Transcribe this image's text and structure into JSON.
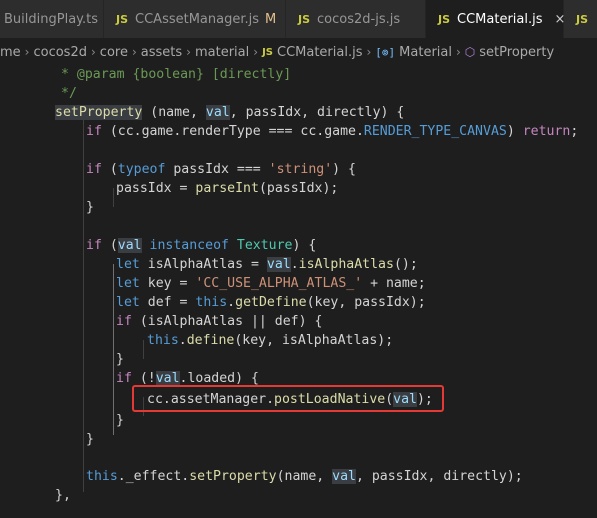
{
  "tabs": [
    {
      "icon": "",
      "label": "BuildingPlay.ts",
      "modified": "",
      "active": false
    },
    {
      "icon": "JS",
      "label": "CCAssetManager.js",
      "modified": "M",
      "active": false
    },
    {
      "icon": "JS",
      "label": "cocos2d-js.js",
      "modified": "",
      "active": false
    },
    {
      "icon": "JS",
      "label": "CCMaterial.js",
      "modified": "",
      "close": "×",
      "active": true
    },
    {
      "icon": "JS",
      "label": "",
      "modified": "",
      "active": false
    }
  ],
  "breadcrumb": {
    "items": [
      "me",
      "cocos2d",
      "core",
      "assets",
      "material"
    ],
    "file": "CCMaterial.js",
    "file_icon": "JS",
    "class": "Material",
    "class_icon": "[⊚]",
    "method": "setProperty",
    "sep": "›"
  },
  "code": {
    "l01": "* @param {boolean} [directly]",
    "l02": "*/",
    "l03_fn": "setProperty",
    "l03_rest": " (name, ",
    "l03_val": "val",
    "l03_rest2": ", passIdx, directly) {",
    "l04_if": "if",
    "l04_a": " (cc.game.renderType === cc.game.",
    "l04_const": "RENDER_TYPE_CANVAS",
    "l04_b": ") ",
    "l04_ret": "return",
    "l04_c": ";",
    "l06_if": "if",
    "l06_a": " (",
    "l06_typeof": "typeof",
    "l06_b": " passIdx === ",
    "l06_str": "'string'",
    "l06_c": ") {",
    "l07_a": "passIdx = ",
    "l07_fn": "parseInt",
    "l07_b": "(passIdx);",
    "l08": "}",
    "l10_if": "if",
    "l10_a": " (",
    "l10_val": "val",
    "l10_inst": " instanceof ",
    "l10_type": "Texture",
    "l10_b": ") {",
    "l11_let": "let",
    "l11_a": " isAlphaAtlas = ",
    "l11_val": "val",
    "l11_b": ".",
    "l11_fn": "isAlphaAtlas",
    "l11_c": "();",
    "l12_let": "let",
    "l12_a": " key = ",
    "l12_str": "'CC_USE_ALPHA_ATLAS_'",
    "l12_b": " + name;",
    "l13_let": "let",
    "l13_a": " def = ",
    "l13_this": "this",
    "l13_b": ".",
    "l13_fn": "getDefine",
    "l13_c": "(key, passIdx);",
    "l14_if": "if",
    "l14_a": " (isAlphaAtlas || def) {",
    "l15_this": "this",
    "l15_a": ".",
    "l15_fn": "define",
    "l15_b": "(key, isAlphaAtlas);",
    "l16": "}",
    "l17_if": "if",
    "l17_a": " (!",
    "l17_val": "val",
    "l17_b": ".loaded) {",
    "l18_a": "cc.assetManager.",
    "l18_fn": "postLoadNative",
    "l18_b": "(",
    "l18_val": "val",
    "l18_c": ");",
    "l19": "}",
    "l20": "}",
    "l22_this": "this",
    "l22_a": "._effect.",
    "l22_fn": "setProperty",
    "l22_b": "(name, ",
    "l22_val": "val",
    "l22_c": ", passIdx, directly);",
    "l23": "},"
  },
  "colors": {
    "highlight_box": "#e53935",
    "keyword": "#569cd6",
    "control": "#c586c0",
    "function": "#dcdcaa",
    "variable": "#9cdcfe",
    "string": "#ce9178",
    "type": "#4ec9b0",
    "comment": "#6a9955"
  }
}
